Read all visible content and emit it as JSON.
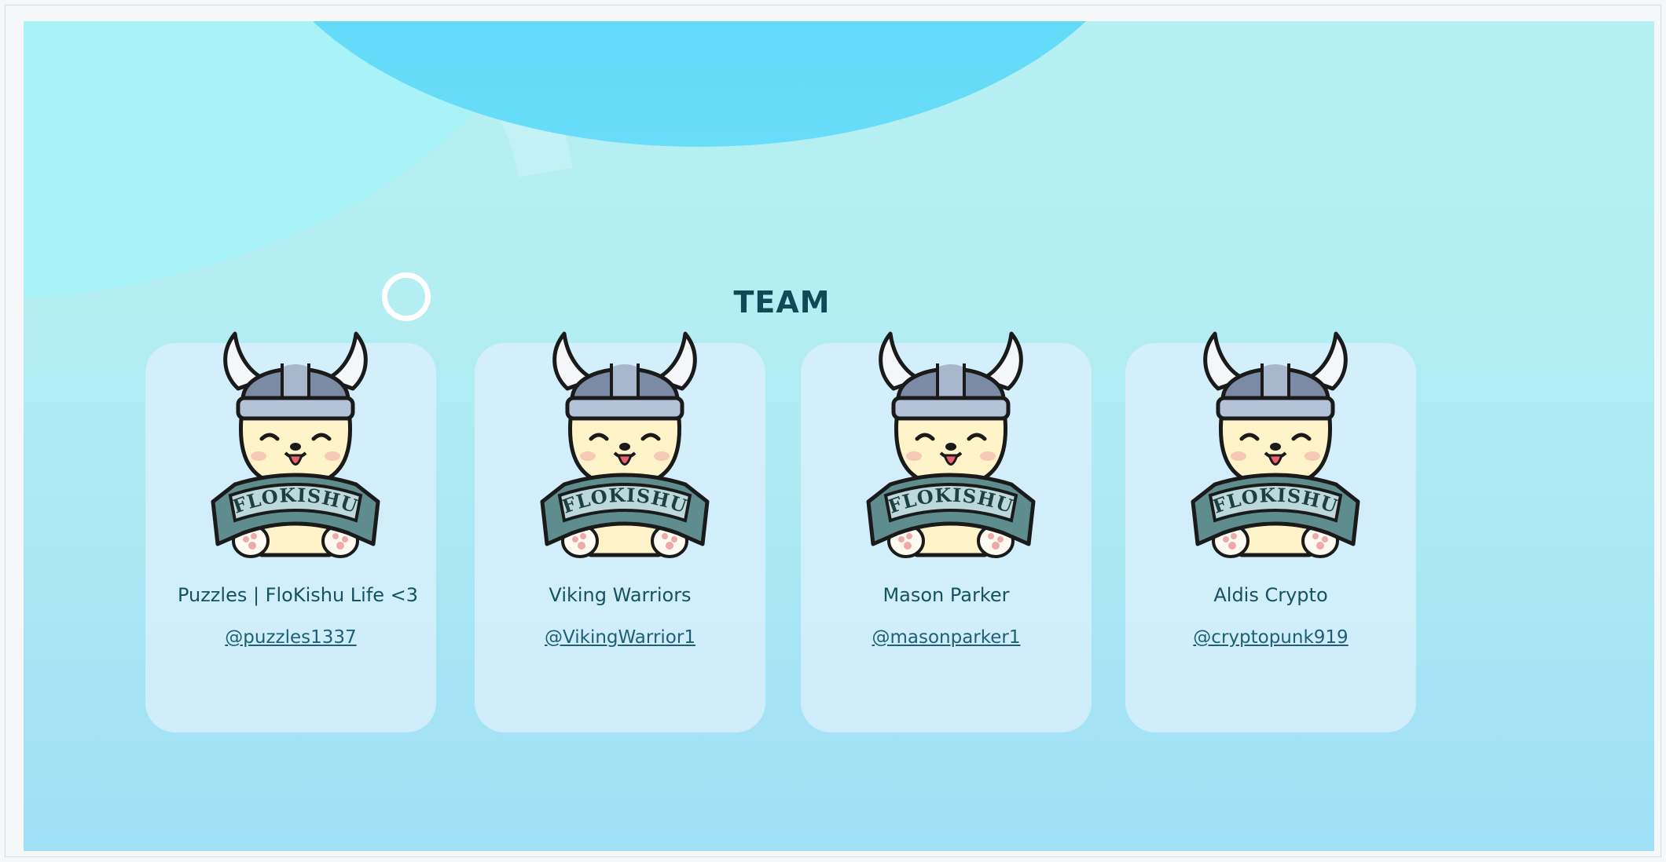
{
  "section": {
    "title": "TEAM"
  },
  "colors": {
    "title": "#0f4a56",
    "text": "#155262",
    "card_bg": "#dcefff",
    "background_top": "#b7f0f2",
    "background_bottom": "#9fe0f6",
    "accent_blob": "#52d6f7"
  },
  "mascot": {
    "icon": "flokishu-viking-dog-icon",
    "banner_text": "FLOKISHU"
  },
  "team": [
    {
      "name": "Puzzles | FloKishu Life <3",
      "handle": "@puzzles1337"
    },
    {
      "name": "Viking Warriors",
      "handle": "@VikingWarrior1"
    },
    {
      "name": "Mason Parker",
      "handle": "@masonparker1"
    },
    {
      "name": "Aldis Crypto",
      "handle": "@cryptopunk919"
    }
  ]
}
